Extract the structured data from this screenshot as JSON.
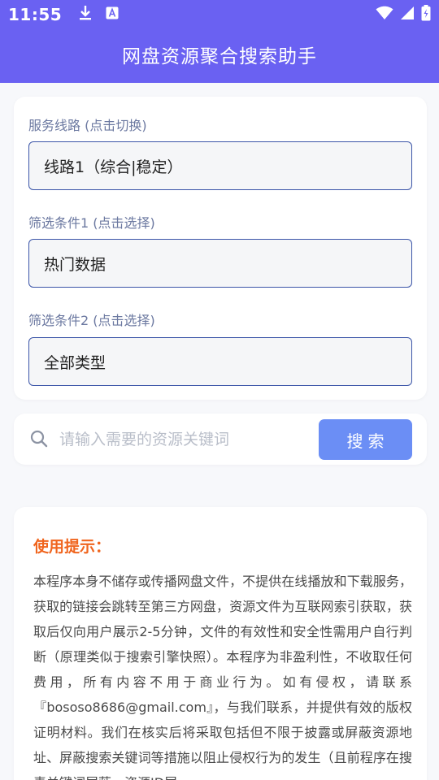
{
  "status_bar": {
    "time": "11:55",
    "icons": [
      "download-icon",
      "font-a-icon",
      "wifi-icon",
      "signal-icon",
      "battery-charging-icon"
    ]
  },
  "header": {
    "title": "网盘资源聚合搜索助手"
  },
  "filters": {
    "route_label": "服务线路 (点击切换)",
    "route_value": "线路1（综合|稳定）",
    "filter1_label": "筛选条件1 (点击选择)",
    "filter1_value": "热门数据",
    "filter2_label": "筛选条件2 (点击选择)",
    "filter2_value": "全部类型"
  },
  "search": {
    "placeholder": "请输入需要的资源关键词",
    "value": "",
    "button_label": "搜索"
  },
  "tips": {
    "title": "使用提示：",
    "body": "本程序本身不储存或传播网盘文件，不提供在线播放和下载服务，获取的链接会跳转至第三方网盘，资源文件为互联网索引获取，获取后仅向用户展示2-5分钟，文件的有效性和安全性需用户自行判断（原理类似于搜索引擎快照）。本程序为非盈利性，不收取任何费用，所有内容不用于商业行为。如有侵权，请联系『bososo8686@gmail.com』，与我们联系，并提供有效的版权证明材料。我们在核实后将采取包括但不限于披露或屏蔽资源地址、屏蔽搜索关键词等措施以阻止侵权行为的发生（且前程序在搜素关键词屏蔽，资源ID屏"
  },
  "colors": {
    "header_bg": "#6a61f2",
    "accent_orange": "#f0651e",
    "search_button": "#6b8ef5",
    "field_border": "#3b55a8"
  }
}
